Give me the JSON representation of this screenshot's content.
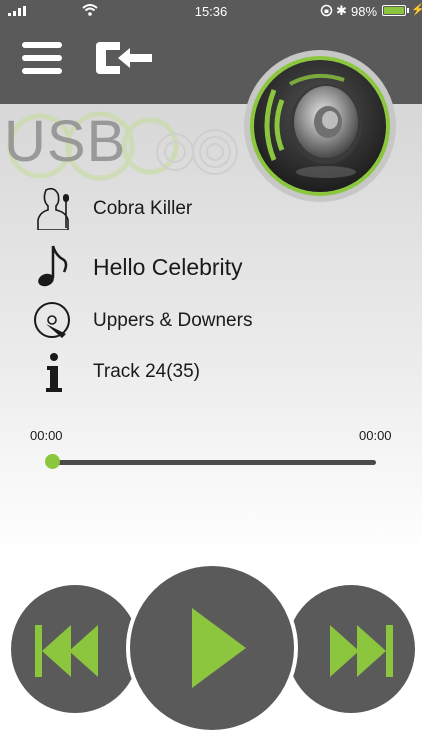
{
  "status_bar": {
    "time": "15:36",
    "battery_percent_label": "98%",
    "battery_level": 0.98,
    "icons": [
      "signal-icon",
      "wifi-icon",
      "rotation-lock-icon",
      "bluetooth-icon",
      "battery-icon",
      "charging-icon"
    ]
  },
  "toolbar": {
    "menu_icon": "hamburger-menu-icon",
    "source_icon": "source-switch-icon",
    "speaker_icon": "speaker-icon"
  },
  "source": {
    "label": "USB"
  },
  "track_info": {
    "artist": "Cobra Killer",
    "title": "Hello Celebrity",
    "album": "Uppers & Downers",
    "track_number": "Track 24(35)"
  },
  "progress": {
    "elapsed": "00:00",
    "total": "00:00",
    "fraction": 0.0
  },
  "colors": {
    "accent": "#8cc63f",
    "bar_dark": "#5a5a5a",
    "text": "#1a1a1a"
  },
  "controls": {
    "previous_icon": "skip-previous-icon",
    "play_icon": "play-icon",
    "next_icon": "skip-next-icon"
  }
}
